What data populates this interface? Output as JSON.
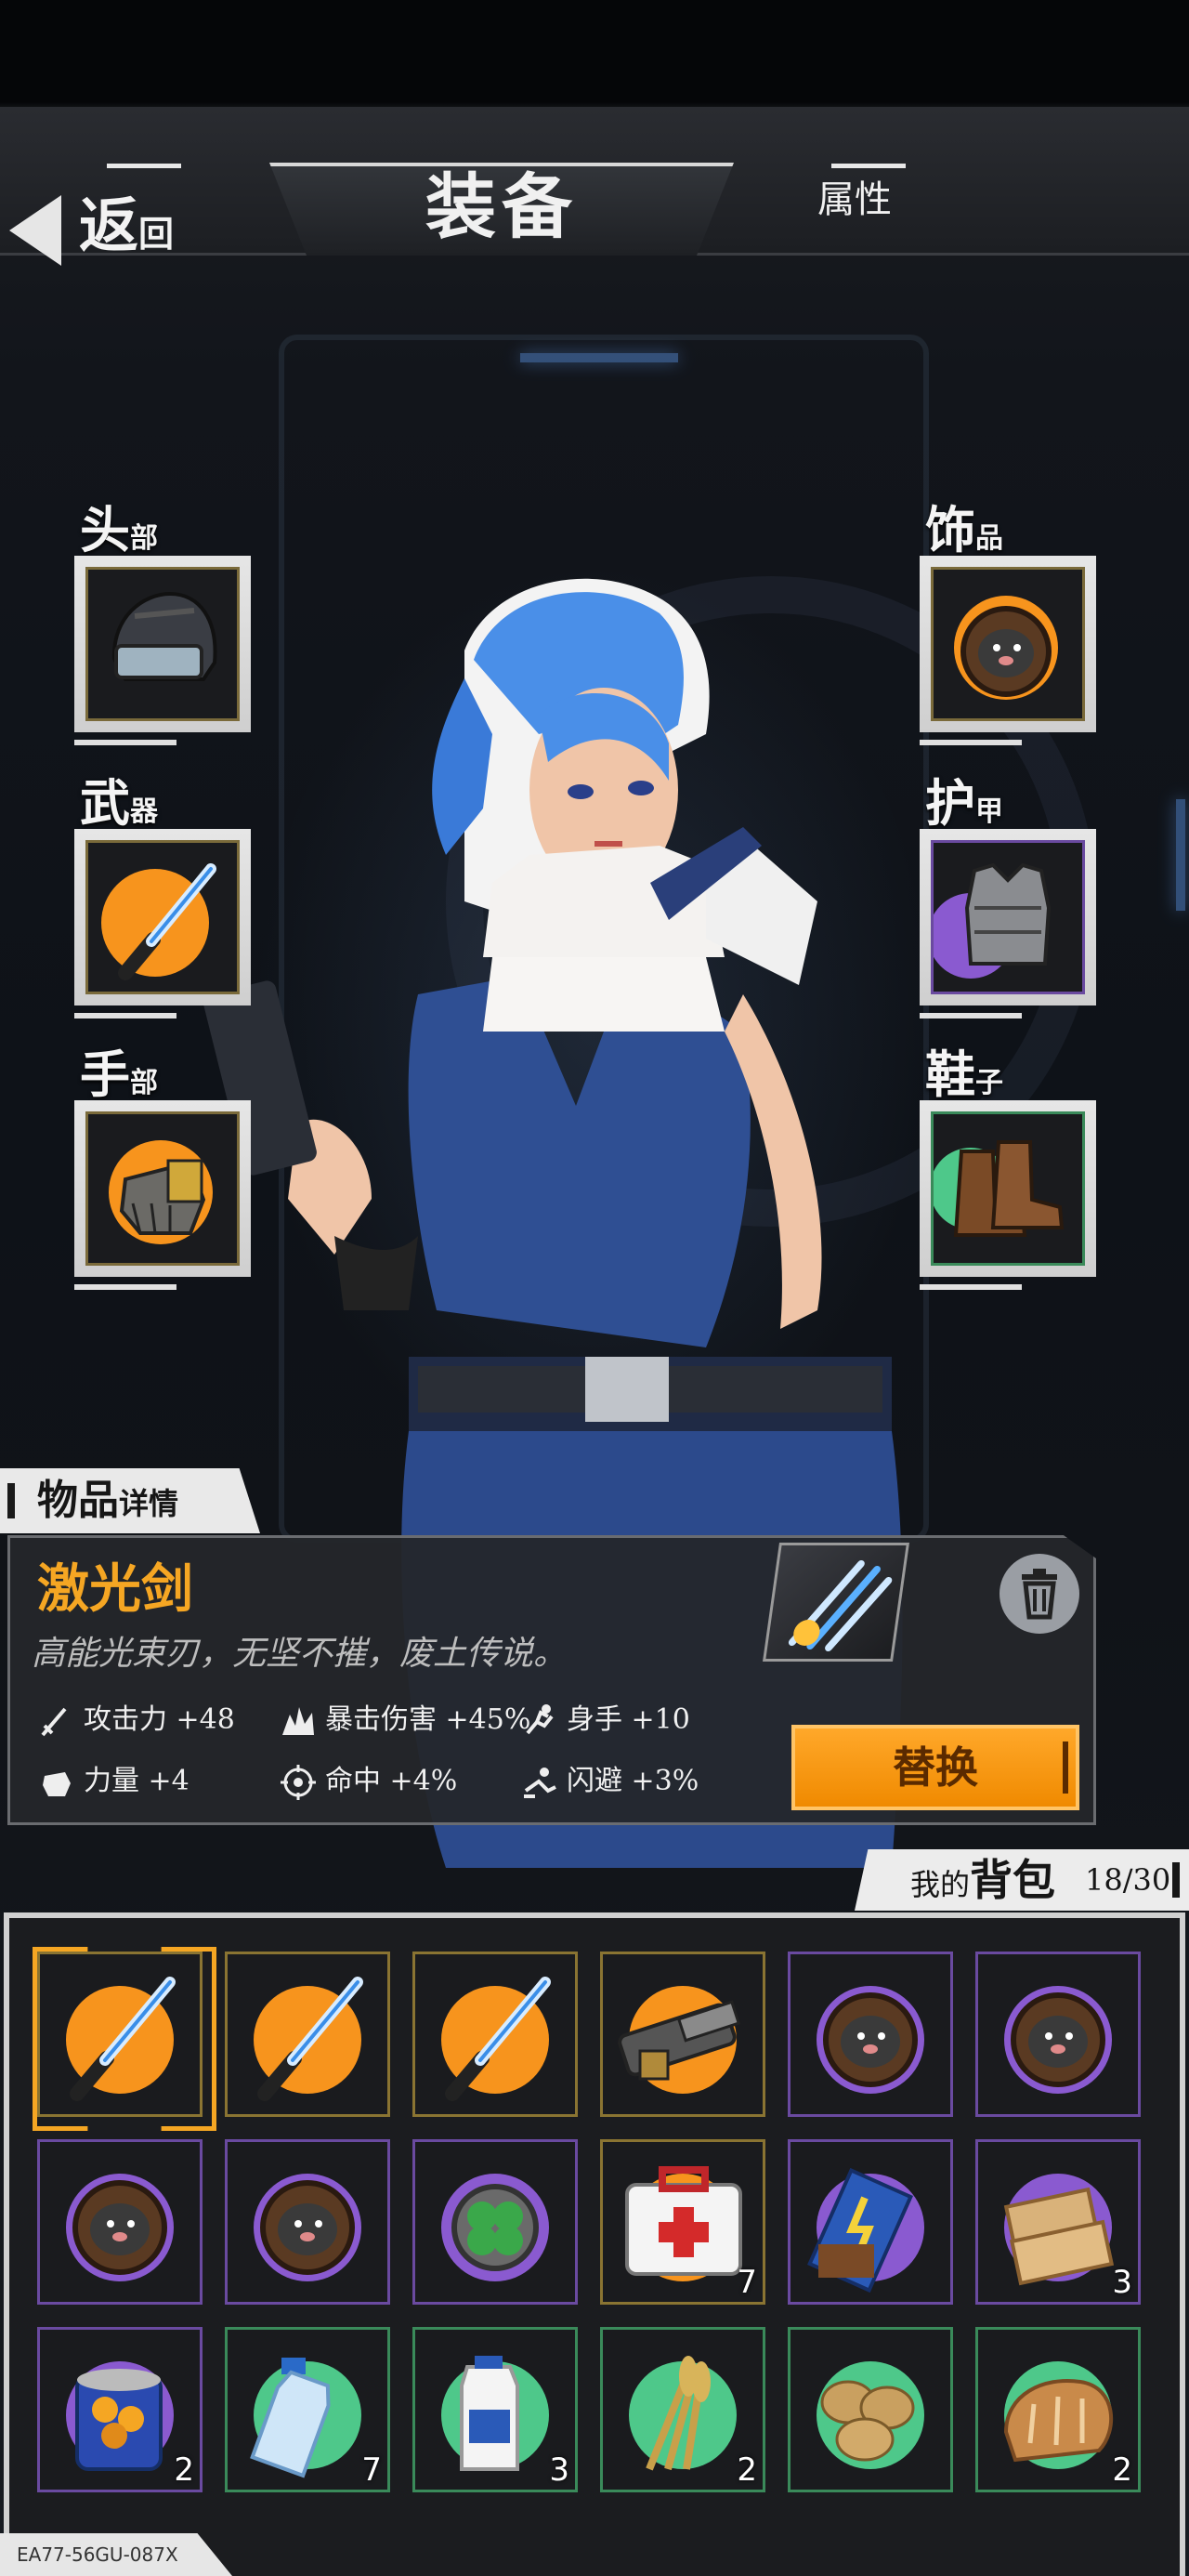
{
  "header": {
    "title": "装备",
    "back_label": "返",
    "back_label_small": "回",
    "attr_tab": "属性"
  },
  "slots": {
    "head": {
      "label": "头",
      "label_small": "部",
      "item": "helmet-icon"
    },
    "weapon": {
      "label": "武",
      "label_small": "器",
      "item": "laser-sword-icon"
    },
    "hands": {
      "label": "手",
      "label_small": "部",
      "item": "gauntlet-icon"
    },
    "accessory": {
      "label": "饰",
      "label_small": "品",
      "item": "mole-charm-icon"
    },
    "armor": {
      "label": "护",
      "label_small": "甲",
      "item": "vest-icon"
    },
    "shoes": {
      "label": "鞋",
      "label_small": "子",
      "item": "boots-icon"
    }
  },
  "detail": {
    "tag": "物品",
    "tag_small": "详情",
    "name": "激光剑",
    "description": "高能光束刃，无坚不摧，废土传说。",
    "stats": [
      {
        "icon": "sword-icon",
        "text": "攻击力 +48"
      },
      {
        "icon": "crit-icon",
        "text": "暴击伤害 +45%"
      },
      {
        "icon": "agility-icon",
        "text": "身手 +10"
      },
      {
        "icon": "fist-icon",
        "text": "力量 +4"
      },
      {
        "icon": "target-icon",
        "text": "命中 +4%"
      },
      {
        "icon": "dodge-icon",
        "text": "闪避 +3%"
      }
    ],
    "replace_label": "替换"
  },
  "backpack": {
    "title_small": "我的",
    "title": "背包",
    "count": "18/30",
    "items": [
      {
        "name": "laser-sword",
        "rarity": "orange",
        "qty": ""
      },
      {
        "name": "laser-sword",
        "rarity": "orange",
        "qty": ""
      },
      {
        "name": "laser-sword",
        "rarity": "orange",
        "qty": ""
      },
      {
        "name": "gatling-gun",
        "rarity": "orange",
        "qty": ""
      },
      {
        "name": "mole-charm",
        "rarity": "purple",
        "qty": ""
      },
      {
        "name": "mole-charm",
        "rarity": "purple",
        "qty": ""
      },
      {
        "name": "mole-charm",
        "rarity": "purple",
        "qty": ""
      },
      {
        "name": "mole-charm",
        "rarity": "purple",
        "qty": ""
      },
      {
        "name": "clover-charm",
        "rarity": "purple",
        "qty": ""
      },
      {
        "name": "first-aid-kit",
        "rarity": "orange",
        "qty": "7"
      },
      {
        "name": "energy-bar",
        "rarity": "purple",
        "qty": ""
      },
      {
        "name": "biscuits",
        "rarity": "purple",
        "qty": "3"
      },
      {
        "name": "canned-fruit",
        "rarity": "purple",
        "qty": "2"
      },
      {
        "name": "water-bottle",
        "rarity": "green",
        "qty": "7"
      },
      {
        "name": "milk-jug",
        "rarity": "green",
        "qty": "3"
      },
      {
        "name": "wheat",
        "rarity": "green",
        "qty": "2"
      },
      {
        "name": "potatoes",
        "rarity": "green",
        "qty": ""
      },
      {
        "name": "bread",
        "rarity": "green",
        "qty": "2"
      }
    ]
  },
  "footer_code": "EA77-56GU-087X",
  "colors": {
    "accent": "#f5a623",
    "orange_rarity": "#f7941d",
    "purple_rarity": "#8a5ad0",
    "green_rarity": "#4ec88a"
  }
}
